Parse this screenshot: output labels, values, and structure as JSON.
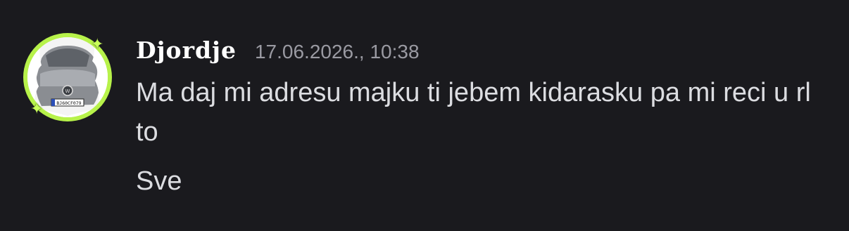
{
  "message": {
    "author": "Djordje",
    "timestamp": "17.06.2026., 10:38",
    "lines": [
      "Ma daj mi adresu majku ti jebem kidarasku pa mi reci u rl to",
      "Sve"
    ]
  },
  "avatar": {
    "plate_text": "BJ60CF079",
    "ring_color": "#b7f24a"
  }
}
